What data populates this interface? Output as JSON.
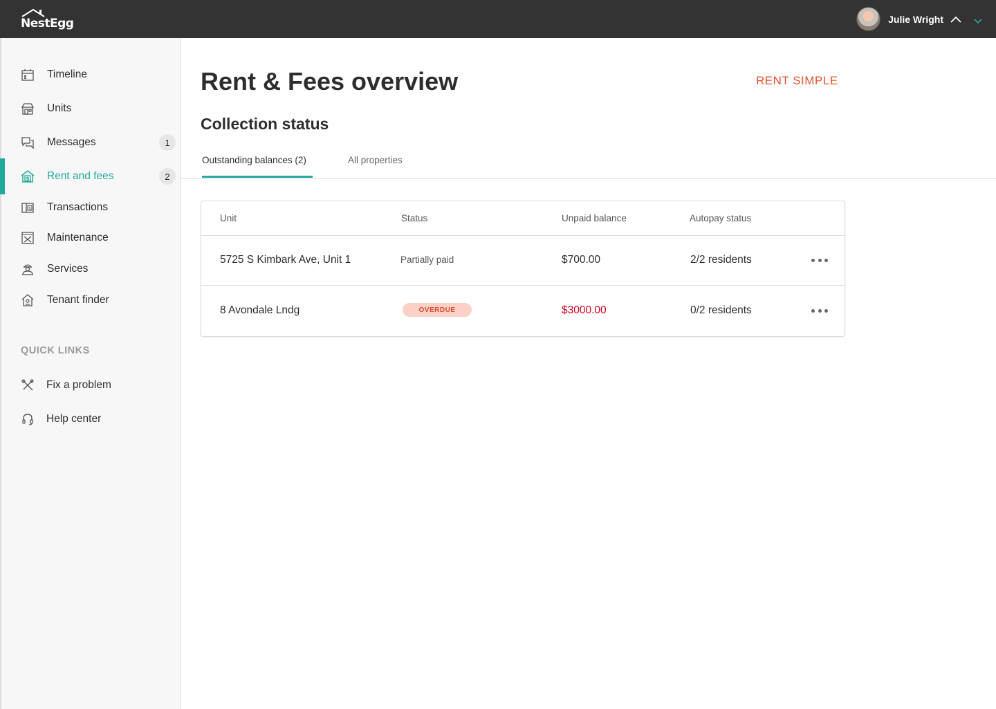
{
  "header": {
    "logo_text": "NestEgg",
    "user_name": "Julie Wright"
  },
  "sidebar": {
    "items": [
      {
        "label": "Timeline",
        "icon": "calendar-icon"
      },
      {
        "label": "Units",
        "icon": "storefront-icon"
      },
      {
        "label": "Messages",
        "icon": "chat-bubbles-icon",
        "badge": "1"
      },
      {
        "label": "Rent and fees",
        "icon": "house-dollar-icon",
        "badge": "2",
        "active": true
      },
      {
        "label": "Transactions",
        "icon": "wallet-icon"
      },
      {
        "label": "Maintenance",
        "icon": "tools-box-icon"
      },
      {
        "label": "Services",
        "icon": "worker-icon"
      },
      {
        "label": "Tenant finder",
        "icon": "house-search-icon"
      }
    ],
    "quick_links_title": "QUICK LINKS",
    "quick_links": [
      {
        "label": "Fix a problem",
        "icon": "wrench-screwdriver-icon"
      },
      {
        "label": "Help center",
        "icon": "headset-icon"
      }
    ]
  },
  "main": {
    "title": "Rent & Fees overview",
    "action_label": "RENT SIMPLE",
    "section_title": "Collection status",
    "tabs": [
      {
        "label": "Outstanding balances (2)",
        "active": true
      },
      {
        "label": "All properties",
        "active": false
      }
    ],
    "table": {
      "headers": [
        "Unit",
        "Status",
        "Unpaid balance",
        "Autopay status"
      ],
      "rows": [
        {
          "unit": "5725 S Kimbark Ave, Unit 1",
          "status": "Partially paid",
          "balance": "$700.00",
          "autopay": "2/2 residents"
        },
        {
          "unit": "8 Avondale Lndg",
          "status": "OVERDUE",
          "balance": "$3000.00",
          "autopay": "0/2 residents"
        }
      ]
    }
  },
  "colors": {
    "accent": "#23a999",
    "action": "#e0542e",
    "overdue_text": "#d0021b",
    "topbar": "#333333"
  }
}
